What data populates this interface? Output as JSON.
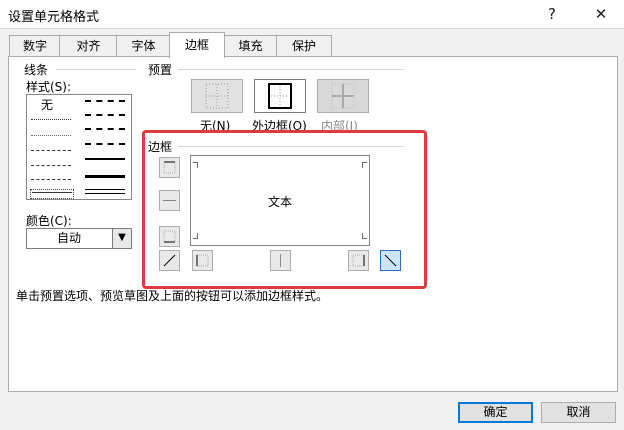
{
  "window": {
    "title": "设置单元格格式",
    "help": "?",
    "close": "✕"
  },
  "tabs": [
    {
      "label": "数字"
    },
    {
      "label": "对齐"
    },
    {
      "label": "字体"
    },
    {
      "label": "边框",
      "active": true
    },
    {
      "label": "填充"
    },
    {
      "label": "保护"
    }
  ],
  "line": {
    "group_label": "线条",
    "style_label": "样式(S):",
    "none_label": "无",
    "color_label": "颜色(C):",
    "color_value": "自动"
  },
  "presets": {
    "group_label": "预置",
    "none": "无(N)",
    "outline": "外边框(O)",
    "inside": "内部(I)"
  },
  "border": {
    "group_label": "边框",
    "preview_text": "文本"
  },
  "hint": "单击预置选项、预览草图及上面的按钮可以添加边框样式。",
  "buttons": {
    "ok": "确定",
    "cancel": "取消"
  },
  "colors": {
    "highlight_frame": "#e0393e",
    "selected_border_button": "#cce4f7"
  }
}
